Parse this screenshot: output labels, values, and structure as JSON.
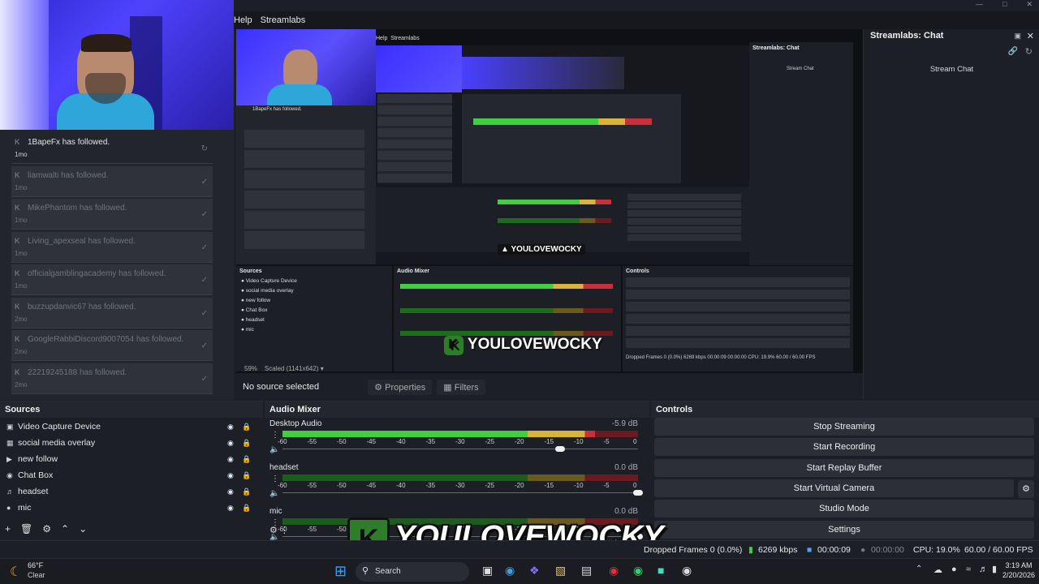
{
  "menu": {
    "help": "Help",
    "streamlabs": "Streamlabs"
  },
  "feed": [
    {
      "name": "1BapeFx",
      "suffix": " has followed.",
      "time": "1mo",
      "active": true
    },
    {
      "name": "liamwalti",
      "suffix": " has followed.",
      "time": "1mo",
      "active": false
    },
    {
      "name": "MikePhantom",
      "suffix": " has followed.",
      "time": "1mo",
      "active": false
    },
    {
      "name": "Living_apexseal",
      "suffix": " has followed.",
      "time": "1mo",
      "active": false
    },
    {
      "name": "officialgamblingacademy",
      "suffix": " has followed.",
      "time": "1mo",
      "active": false
    },
    {
      "name": "buzzupdanvic67",
      "suffix": " has followed.",
      "time": "2mo",
      "active": false
    },
    {
      "name": "GoogleRabbiDiscord9007054",
      "suffix": " has followed.",
      "time": "2mo",
      "active": false
    },
    {
      "name": "22219245188",
      "suffix": " has followed.",
      "time": "2mo",
      "active": false
    }
  ],
  "chat": {
    "title": "Streamlabs: Chat",
    "stream_chat": "Stream Chat"
  },
  "preview": {
    "zoom": "59%",
    "scale": "Scaled (1141x642)",
    "no_source": "No source selected",
    "properties": "Properties",
    "filters": "Filters",
    "nested_title": "Streamlabs: Chat",
    "nested_stream_chat": "Stream Chat",
    "nested_help": "Help",
    "nested_streamlabs": "Streamlabs",
    "nested_stats": "Dropped Frames 0 (0.0%)   6269 kbps   00:00:09   00:00:00   CPU: 19.9%   60.00 / 60.00 FPS",
    "nested_sources": "Sources",
    "nested_mixer": "Audio Mixer",
    "nested_controls": "Controls"
  },
  "sources": {
    "title": "Sources",
    "items": [
      {
        "label": "Video Capture Device",
        "icon": "camera-icon"
      },
      {
        "label": "social media overlay",
        "icon": "image-icon"
      },
      {
        "label": "new follow",
        "icon": "play-icon"
      },
      {
        "label": "Chat Box",
        "icon": "globe-icon"
      },
      {
        "label": "headset",
        "icon": "speaker-icon"
      },
      {
        "label": "mic",
        "icon": "mic-icon"
      }
    ]
  },
  "mixer": {
    "title": "Audio Mixer",
    "channels": [
      {
        "name": "Desktop Audio",
        "db": "-5.9 dB",
        "level": 0.88,
        "fader": 0.78
      },
      {
        "name": "headset",
        "db": "0.0 dB",
        "level": 0.0,
        "fader": 1.0
      },
      {
        "name": "mic",
        "db": "0.0 dB",
        "level": 0.0,
        "fader": 1.0
      }
    ],
    "scale": [
      "-60",
      "-55",
      "-50",
      "-45",
      "-40",
      "-35",
      "-30",
      "-25",
      "-20",
      "-15",
      "-10",
      "-5",
      "0"
    ]
  },
  "controls": {
    "title": "Controls",
    "buttons": [
      "Stop Streaming",
      "Start Recording",
      "Start Replay Buffer",
      "Start Virtual Camera",
      "Studio Mode",
      "Settings"
    ]
  },
  "overlay": {
    "brand": "YOULOVEWOCKY",
    "k": "K"
  },
  "status": {
    "dropped": "Dropped Frames 0 (0.0%)",
    "kbps": "6269 kbps",
    "stream_time": "00:00:09",
    "rec_time": "00:00:00",
    "cpu": "CPU: 19.0%",
    "fps": "60.00 / 60.00 FPS"
  },
  "taskbar": {
    "temp": "66°F",
    "weather": "Clear",
    "search": "Search",
    "time": "3:19 AM",
    "date": "2/20/2026"
  },
  "colors": {
    "green": "#3fcf3f",
    "yellow": "#d9b43a",
    "red": "#c8313b",
    "accent": "#2e7d2a"
  }
}
